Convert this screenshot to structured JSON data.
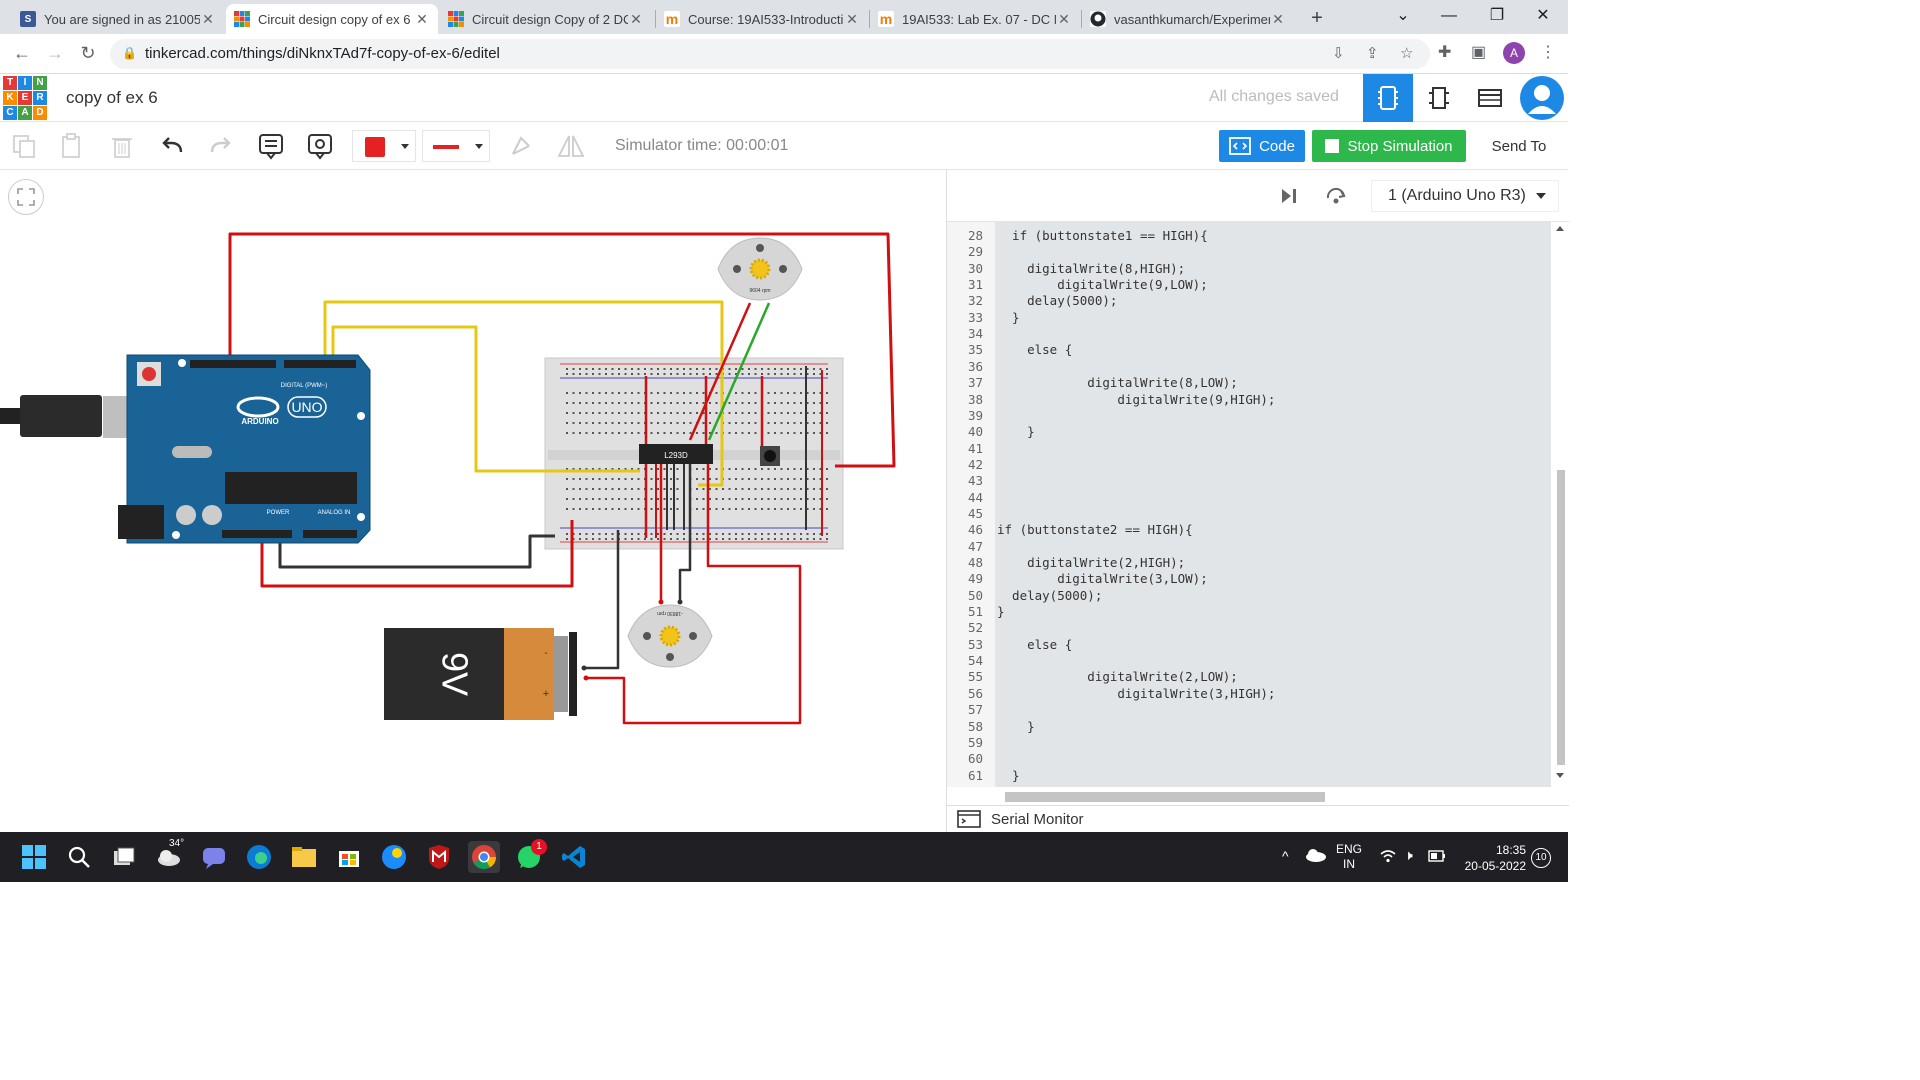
{
  "browser": {
    "tabs": [
      {
        "title": "You are signed in as 21005",
        "favicon": "S",
        "color": "#3b5998",
        "active": false
      },
      {
        "title": "Circuit design copy of ex 6",
        "favicon": "T",
        "color": "#e53935",
        "active": true
      },
      {
        "title": "Circuit design Copy of 2 DC",
        "favicon": "T",
        "color": "#e53935",
        "active": false
      },
      {
        "title": "Course: 19AI533-Introducti",
        "favicon": "m",
        "color": "#f57c00",
        "active": false
      },
      {
        "title": "19AI533: Lab Ex. 07 - DC M",
        "favicon": "m",
        "color": "#f57c00",
        "active": false
      },
      {
        "title": "vasanthkumarch/Experimen",
        "favicon": "G",
        "color": "#24292e",
        "active": false
      }
    ],
    "url": "tinkercad.com/things/diNknxTAd7f-copy-of-ex-6/editel",
    "profile_initial": "A"
  },
  "app": {
    "logo_letters": [
      "T",
      "I",
      "N",
      "K",
      "E",
      "R",
      "C",
      "A",
      "D"
    ],
    "project_title": "copy of ex 6",
    "save_status": "All changes saved"
  },
  "toolbar": {
    "simulator_time": "Simulator time: 00:00:01",
    "code_label": "Code",
    "stop_label": "Stop Simulation",
    "send_label": "Send To",
    "fill_color": "#e52222",
    "line_color": "#e52222"
  },
  "code_panel": {
    "device": "1 (Arduino Uno R3)",
    "serial_monitor": "Serial Monitor",
    "lines": [
      {
        "n": "28",
        "text": "  if (buttonstate1 == HIGH){"
      },
      {
        "n": "29",
        "text": ""
      },
      {
        "n": "30",
        "text": "    digitalWrite(8,HIGH);"
      },
      {
        "n": "31",
        "text": "        digitalWrite(9,LOW);"
      },
      {
        "n": "32",
        "text": "    delay(5000);"
      },
      {
        "n": "33",
        "text": "  }"
      },
      {
        "n": "34",
        "text": ""
      },
      {
        "n": "35",
        "text": "    else {"
      },
      {
        "n": "36",
        "text": ""
      },
      {
        "n": "37",
        "text": "            digitalWrite(8,LOW);"
      },
      {
        "n": "38",
        "text": "                digitalWrite(9,HIGH);"
      },
      {
        "n": "39",
        "text": ""
      },
      {
        "n": "40",
        "text": "    }"
      },
      {
        "n": "41",
        "text": ""
      },
      {
        "n": "42",
        "text": ""
      },
      {
        "n": "43",
        "text": ""
      },
      {
        "n": "44",
        "text": ""
      },
      {
        "n": "45",
        "text": ""
      },
      {
        "n": "46",
        "text": "if (buttonstate2 == HIGH){"
      },
      {
        "n": "47",
        "text": ""
      },
      {
        "n": "48",
        "text": "    digitalWrite(2,HIGH);"
      },
      {
        "n": "49",
        "text": "        digitalWrite(3,LOW);"
      },
      {
        "n": "50",
        "text": "  delay(5000);"
      },
      {
        "n": "51",
        "text": "}"
      },
      {
        "n": "52",
        "text": ""
      },
      {
        "n": "53",
        "text": "    else {"
      },
      {
        "n": "54",
        "text": ""
      },
      {
        "n": "55",
        "text": "            digitalWrite(2,LOW);"
      },
      {
        "n": "56",
        "text": "                digitalWrite(3,HIGH);"
      },
      {
        "n": "57",
        "text": ""
      },
      {
        "n": "58",
        "text": "    }"
      },
      {
        "n": "59",
        "text": ""
      },
      {
        "n": "60",
        "text": ""
      },
      {
        "n": "61",
        "text": "  }"
      }
    ]
  },
  "circuit": {
    "arduino_label": "ARDUINO",
    "arduino_model": "UNO",
    "arduino_digital_label": "DIGITAL (PWM~)",
    "arduino_power_label": "POWER",
    "arduino_analog_label": "ANALOG IN",
    "chip_label": "L293D",
    "motor1_rpm": "9604 rpm",
    "motor2_rpm": "-18830 rpm",
    "battery_label": "9V",
    "battery_minus": "-",
    "battery_plus": "+"
  },
  "taskbar": {
    "weather": "34°",
    "language": "ENG",
    "region": "IN",
    "time": "18:35",
    "date": "20-05-2022",
    "notifications": "10",
    "whatsapp_badge": "1"
  }
}
